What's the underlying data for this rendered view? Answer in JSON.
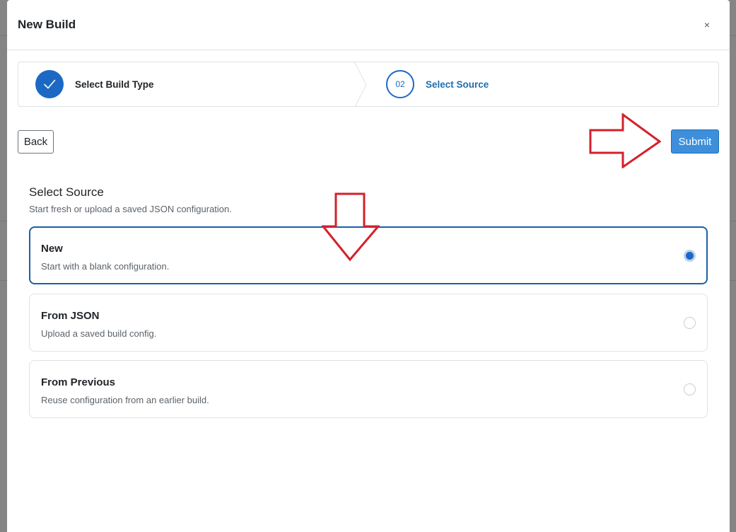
{
  "modal": {
    "title": "New Build",
    "close_symbol": "×"
  },
  "stepper": {
    "steps": [
      {
        "label": "Select Build Type",
        "state": "completed",
        "icon": "check-icon"
      },
      {
        "label": "Select Source",
        "state": "current",
        "number": "02"
      }
    ]
  },
  "actions": {
    "back_label": "Back",
    "submit_label": "Submit"
  },
  "source": {
    "title": "Select Source",
    "subtitle": "Start fresh or upload a saved JSON configuration.",
    "options": [
      {
        "title": "New",
        "description": "Start with a blank configuration.",
        "selected": true
      },
      {
        "title": "From JSON",
        "description": "Upload a saved build config.",
        "selected": false
      },
      {
        "title": "From Previous",
        "description": "Reuse configuration from an earlier build.",
        "selected": false
      }
    ]
  },
  "colors": {
    "accent": "#1c69c5",
    "submit_bg": "#3d8fdc",
    "annotation_arrow": "#d4202b"
  }
}
